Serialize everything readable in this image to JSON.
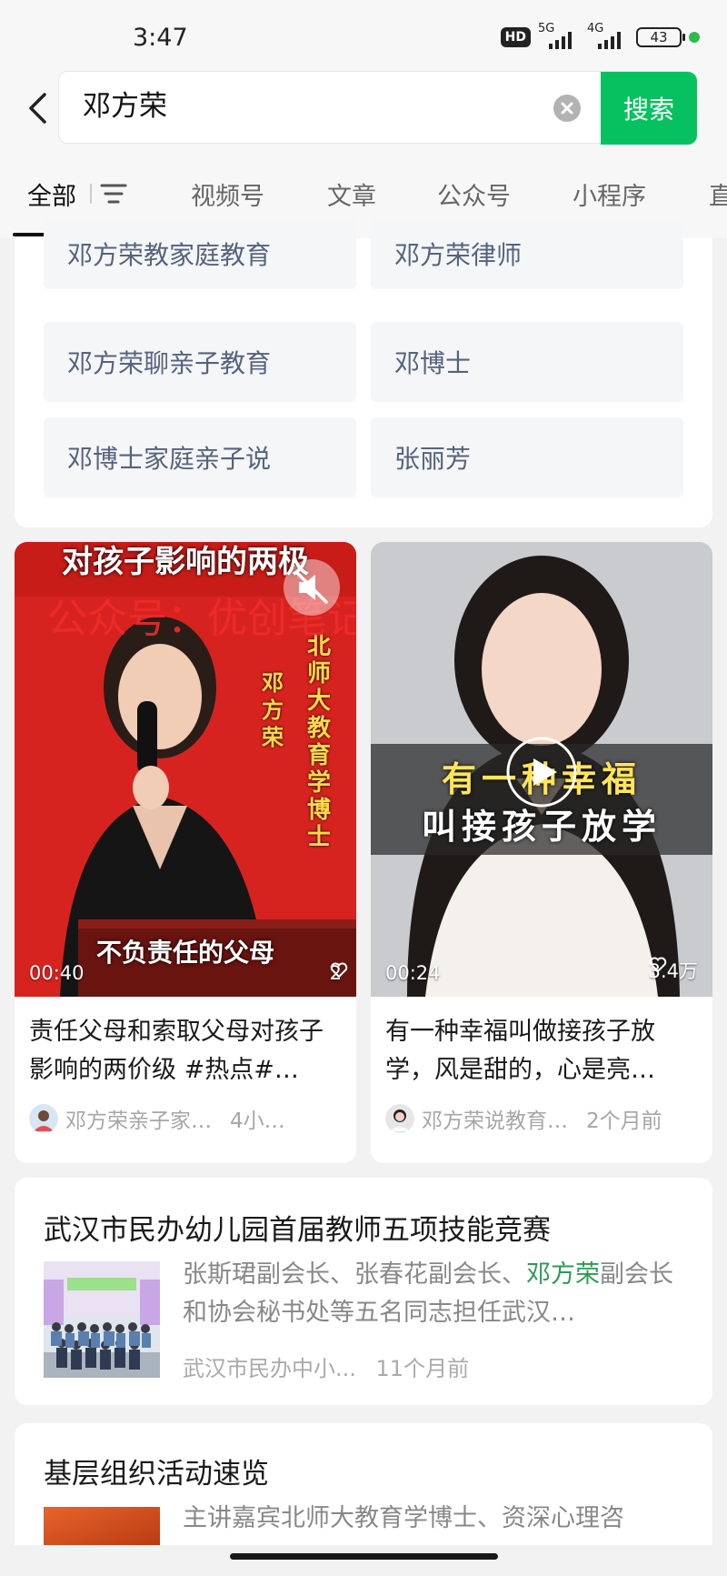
{
  "status_bar": {
    "time": "3:47",
    "hd": "HD",
    "net1": "5G",
    "net2": "4G",
    "battery": "43"
  },
  "search": {
    "query": "邓方荣",
    "button_label": "搜索",
    "back_icon": "chevron-left-icon",
    "clear_icon": "clear-circle-icon"
  },
  "tabs": [
    {
      "label": "全部"
    },
    {
      "label": "视频号"
    },
    {
      "label": "文章"
    },
    {
      "label": "公众号"
    },
    {
      "label": "小程序"
    },
    {
      "label": "直"
    }
  ],
  "related_searches": [
    "邓方荣教家庭教育",
    "邓方荣律师",
    "邓方荣聊亲子教育",
    "邓博士",
    "邓博士家庭亲子说",
    "张丽芳"
  ],
  "videos": [
    {
      "overlay_top": "对孩子影响的两极",
      "overlay_side": "北师大教育学博士",
      "overlay_name": "邓方荣",
      "overlay_bottom": "不负责任的父母",
      "watermark": "公众号：优创笔记",
      "duration": "00:40",
      "likes": "2",
      "title": "责任父母和索取父母对孩子影响的两价级 #热点#…",
      "author": "邓方荣亲子家…",
      "ago": "4小…"
    },
    {
      "overlay_line1": "有一种幸福",
      "overlay_line2": "叫接孩子放学",
      "duration": "00:24",
      "likes": "3.4万",
      "title": "有一种幸福叫做接孩子放学，风是甜的，心是亮…",
      "author": "邓方荣说教育…",
      "ago": "2个月前"
    }
  ],
  "articles": [
    {
      "title": "武汉市民办幼儿园首届教师五项技能竞赛",
      "snippet_before": "张斯珺副会长、张春花副会长、",
      "snippet_highlight": "邓方荣",
      "snippet_after": "副会长和协会秘书处等五名同志担任武汉…",
      "source": "武汉市民办中小...",
      "ago": "11个月前"
    },
    {
      "title": "基层组织活动速览",
      "snippet": "主讲嘉宾北师大教育学博士、资深心理咨"
    }
  ],
  "colors": {
    "accent": "#07c160",
    "highlight": "#2d9b52",
    "chip_text": "#55637d"
  }
}
